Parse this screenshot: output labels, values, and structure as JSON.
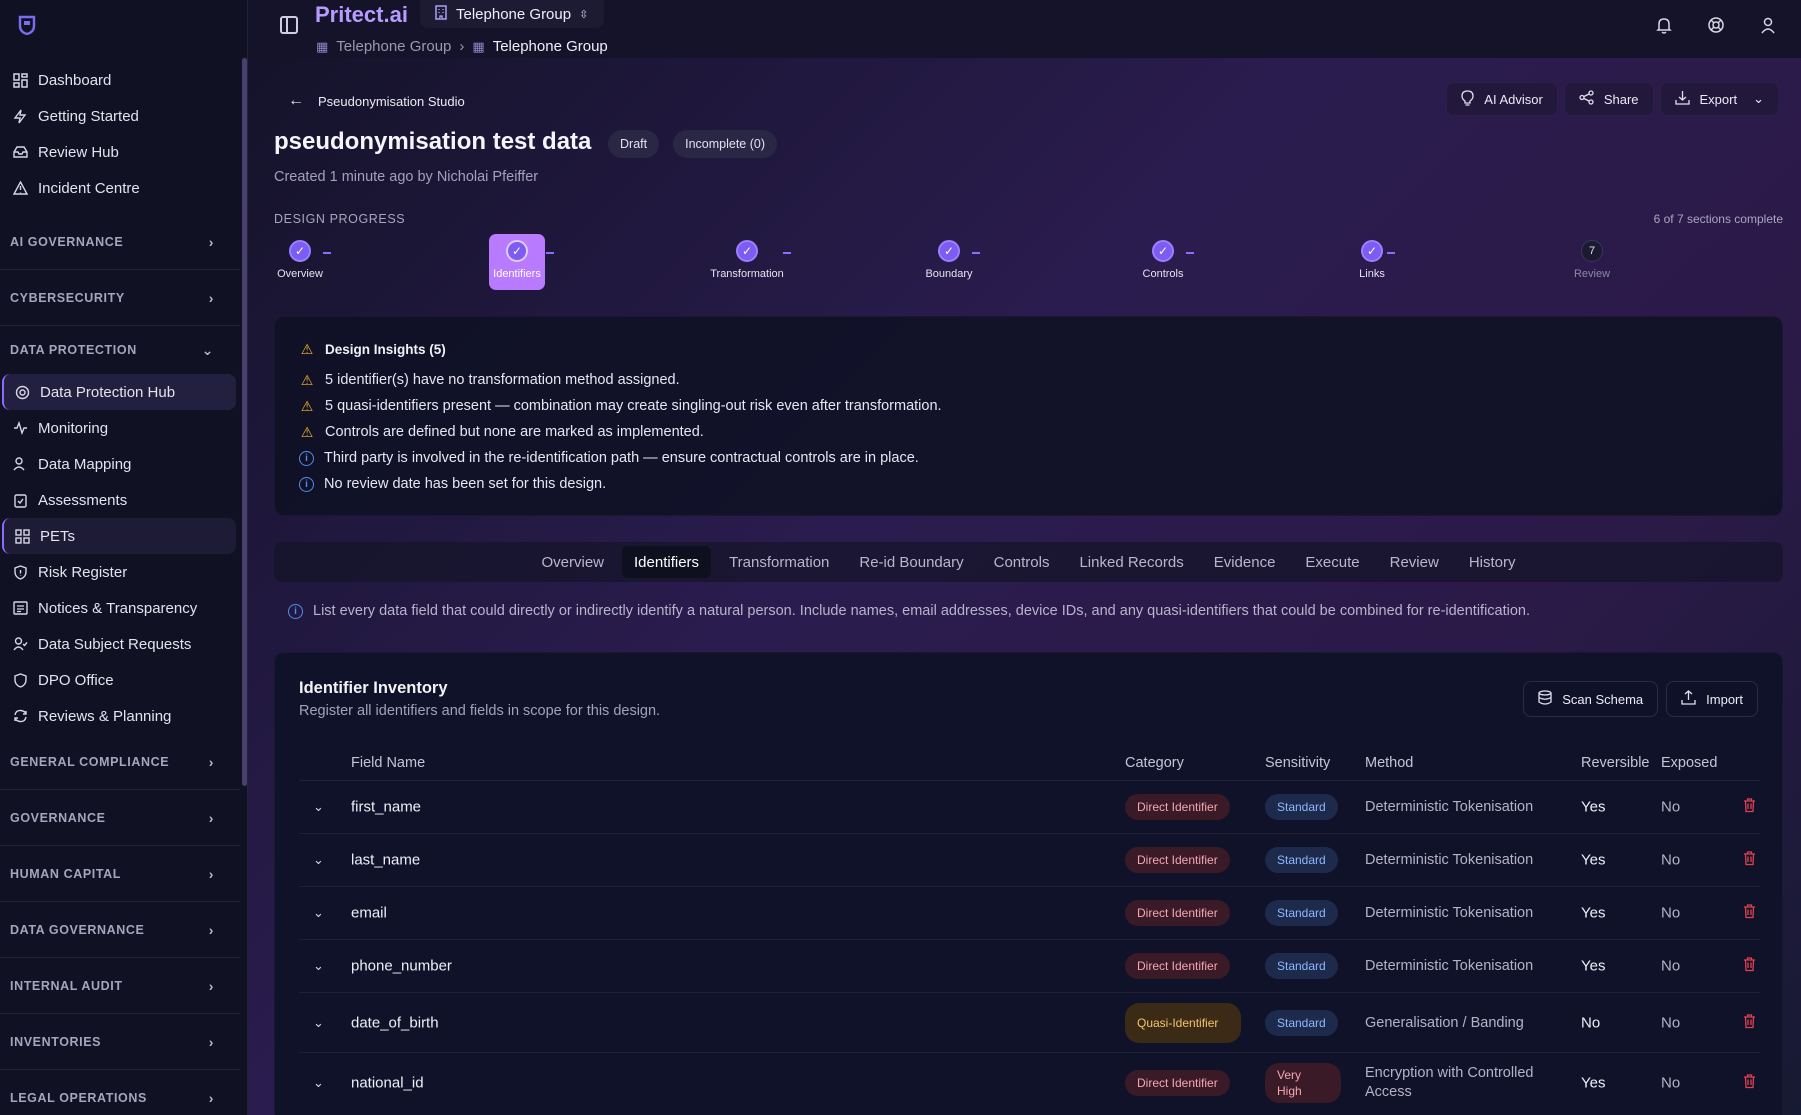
{
  "sidebar": {
    "top_items": [
      {
        "label": "Dashboard",
        "icon": "dashboard-icon"
      },
      {
        "label": "Getting Started",
        "icon": "bolt-icon"
      },
      {
        "label": "Review Hub",
        "icon": "inbox-icon"
      },
      {
        "label": "Incident Centre",
        "icon": "alert-triangle-icon"
      }
    ],
    "sections": {
      "ai_governance": "AI GOVERNANCE",
      "cybersecurity": "CYBERSECURITY",
      "data_protection": "DATA PROTECTION",
      "general_compliance": "GENERAL COMPLIANCE",
      "governance": "GOVERNANCE",
      "human_capital": "HUMAN CAPITAL",
      "data_governance": "DATA GOVERNANCE",
      "internal_audit": "INTERNAL AUDIT",
      "inventories": "INVENTORIES",
      "legal_operations": "LEGAL OPERATIONS"
    },
    "dp_items": [
      {
        "label": "Data Protection Hub"
      },
      {
        "label": "Monitoring"
      },
      {
        "label": "Data Mapping"
      },
      {
        "label": "Assessments"
      },
      {
        "label": "PETs"
      },
      {
        "label": "Risk Register"
      },
      {
        "label": "Notices & Transparency"
      },
      {
        "label": "Data Subject Requests"
      },
      {
        "label": "DPO Office"
      },
      {
        "label": "Reviews & Planning"
      }
    ]
  },
  "topbar": {
    "brand": "Pritect.ai",
    "org": "Telephone Group",
    "breadcrumb": [
      "Telephone Group",
      "Telephone Group"
    ]
  },
  "header": {
    "back_label": "Pseudonymisation Studio",
    "actions": {
      "ai_advisor": "AI Advisor",
      "share": "Share",
      "export": "Export"
    },
    "title": "pseudonymisation test data",
    "badges": {
      "draft": "Draft",
      "incomplete": "Incomplete (0)"
    },
    "created": "Created 1 minute ago by Nicholai Pfeiffer"
  },
  "progress": {
    "label": "DESIGN PROGRESS",
    "summary": "6 of 7 sections complete",
    "steps": [
      {
        "label": "Overview",
        "done": true
      },
      {
        "label": "Identifiers",
        "done": true
      },
      {
        "label": "Transformation",
        "done": true
      },
      {
        "label": "Boundary",
        "done": true
      },
      {
        "label": "Controls",
        "done": true
      },
      {
        "label": "Links",
        "done": true
      },
      {
        "label": "Review",
        "done": false,
        "number": "7"
      }
    ]
  },
  "insights": {
    "title": "Design Insights (5)",
    "items": [
      {
        "type": "warning",
        "text": "5 identifier(s) have no transformation method assigned."
      },
      {
        "type": "warning",
        "text": "5 quasi-identifiers present — combination may create singling-out risk even after transformation."
      },
      {
        "type": "warning",
        "text": "Controls are defined but none are marked as implemented."
      },
      {
        "type": "info",
        "text": "Third party is involved in the re-identification path — ensure contractual controls are in place."
      },
      {
        "type": "info",
        "text": "No review date has been set for this design."
      }
    ]
  },
  "tabs": [
    "Overview",
    "Identifiers",
    "Transformation",
    "Re-id Boundary",
    "Controls",
    "Linked Records",
    "Evidence",
    "Execute",
    "Review",
    "History"
  ],
  "hint": "List every data field that could directly or indirectly identify a natural person. Include names, email addresses, device IDs, and any quasi-identifiers that could be combined for re-identification.",
  "inventory": {
    "title": "Identifier Inventory",
    "subtitle": "Register all identifiers and fields in scope for this design.",
    "scan_label": "Scan Schema",
    "import_label": "Import",
    "columns": {
      "field": "Field Name",
      "category": "Category",
      "sensitivity": "Sensitivity",
      "method": "Method",
      "reversible": "Reversible",
      "exposed": "Exposed"
    },
    "rows": [
      {
        "field": "first_name",
        "category": "Direct Identifier",
        "sensitivity": "Standard",
        "method": "Deterministic Tokenisation",
        "reversible": "Yes",
        "exposed": "No"
      },
      {
        "field": "last_name",
        "category": "Direct Identifier",
        "sensitivity": "Standard",
        "method": "Deterministic Tokenisation",
        "reversible": "Yes",
        "exposed": "No"
      },
      {
        "field": "email",
        "category": "Direct Identifier",
        "sensitivity": "Standard",
        "method": "Deterministic Tokenisation",
        "reversible": "Yes",
        "exposed": "No"
      },
      {
        "field": "phone_number",
        "category": "Direct Identifier",
        "sensitivity": "Standard",
        "method": "Deterministic Tokenisation",
        "reversible": "Yes",
        "exposed": "No"
      },
      {
        "field": "date_of_birth",
        "category": "Quasi-Identifier",
        "sensitivity": "Standard",
        "method": "Generalisation / Banding",
        "reversible": "No",
        "exposed": "No"
      },
      {
        "field": "national_id",
        "category": "Direct Identifier",
        "sensitivity": "Very High",
        "method": "Encryption with Controlled Access",
        "reversible": "Yes",
        "exposed": "No"
      }
    ]
  },
  "colors": {
    "accent": "#8b6cff",
    "brand": "#b69cff",
    "danger": "#e0424f",
    "warning": "#f0b429",
    "info": "#4f8fe8"
  }
}
